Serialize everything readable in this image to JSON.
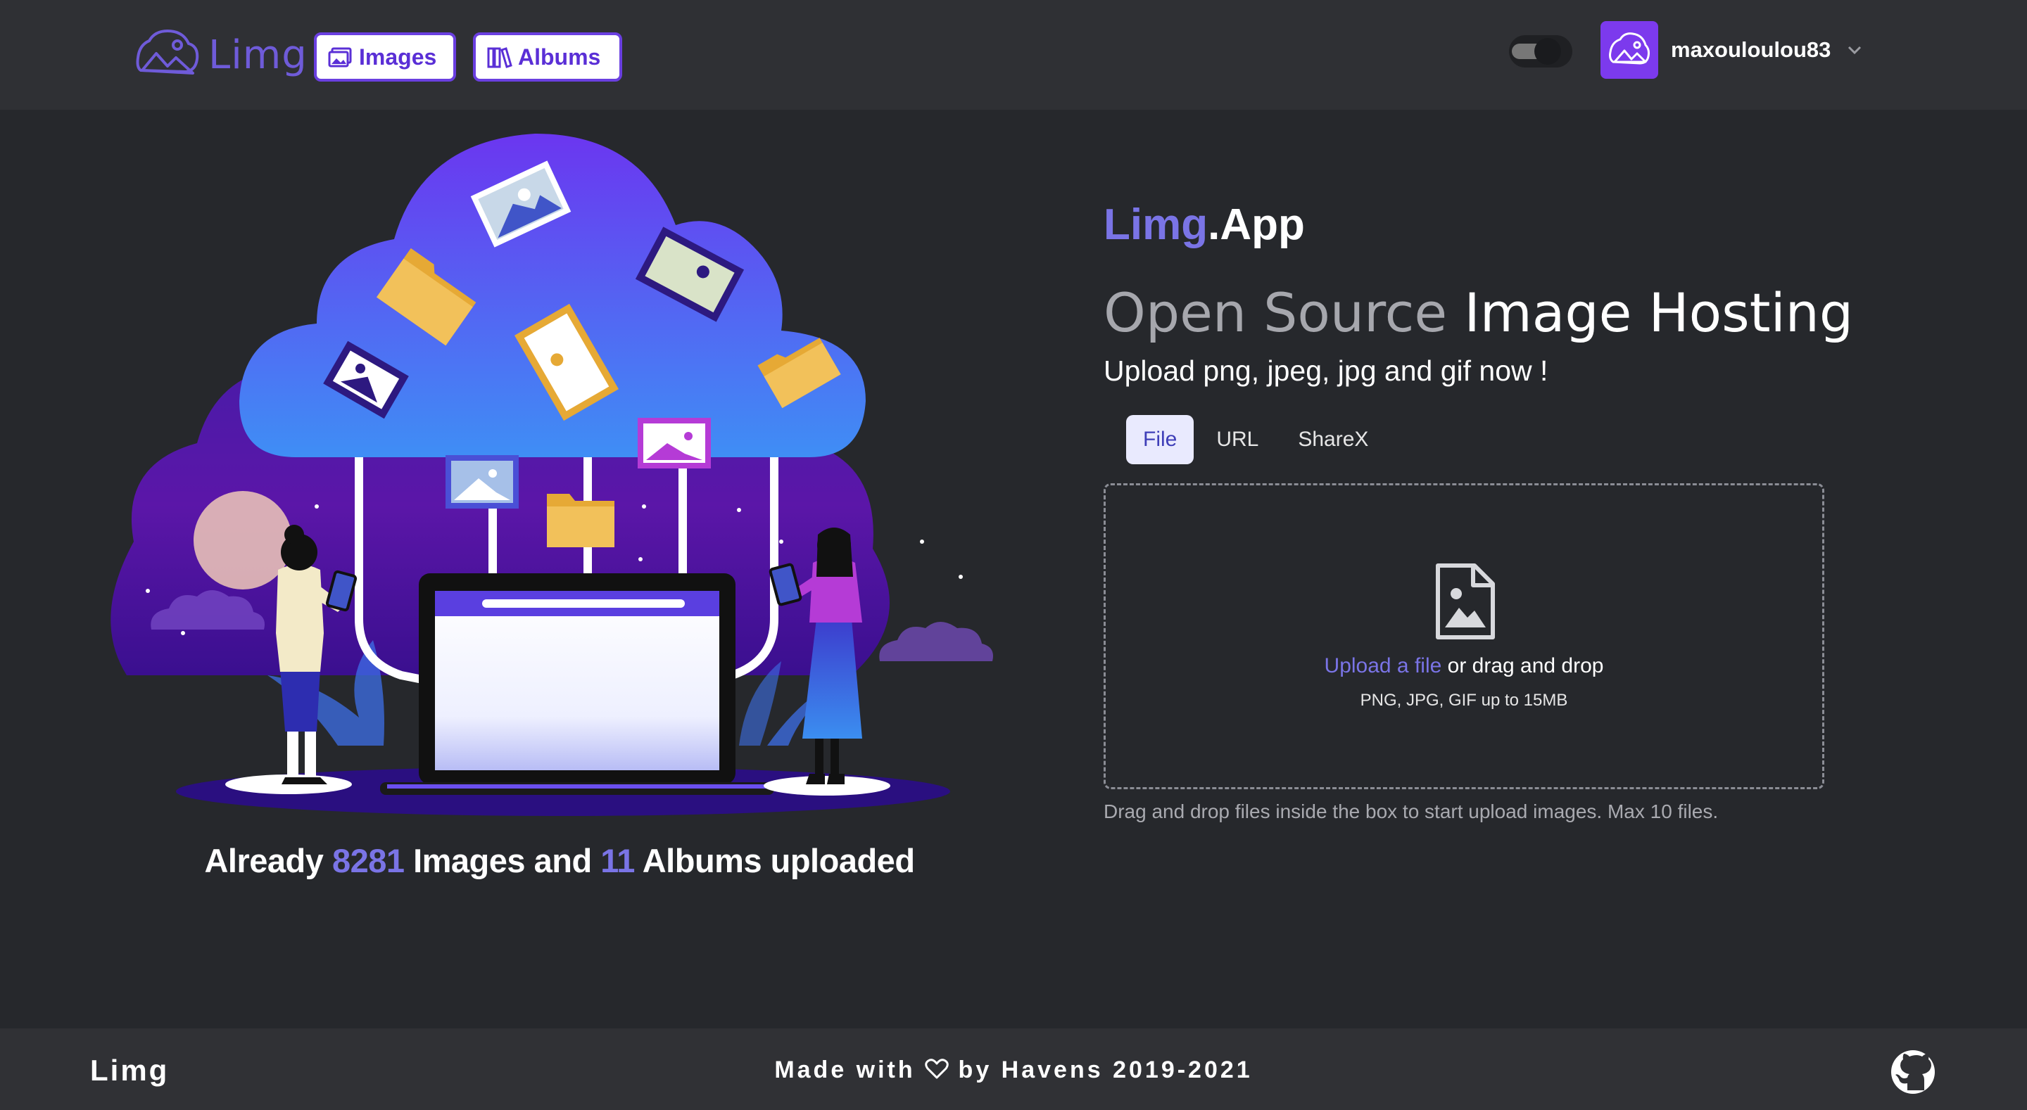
{
  "nav": {
    "logo_text": "Limg",
    "images_label": "Images",
    "albums_label": "Albums",
    "username": "maxouloulou83"
  },
  "hero": {
    "brand_part1": "Limg",
    "brand_part2": ".App",
    "headline_muted": "Open Source",
    "headline_bright": " Image Hosting",
    "subline": "Upload png, jpeg, jpg and gif now !",
    "stats_prefix": "Already ",
    "images_count": "8281",
    "stats_mid": " Images and ",
    "albums_count": "11",
    "stats_suffix": " Albums uploaded"
  },
  "upload": {
    "tabs": [
      "File",
      "URL",
      "ShareX"
    ],
    "active_tab": "File",
    "link_text": "Upload a file",
    "rest_text": " or drag and drop",
    "formats": "PNG, JPG, GIF up to 15MB",
    "hint": "Drag and drop files inside the box to start upload images. Max 10 files."
  },
  "footer": {
    "brand": "Limg",
    "made_prefix": "Made with ",
    "made_suffix": " by Havens 2019-2021"
  },
  "colors": {
    "accent": "#7a74e6",
    "nav_bg": "#2f3034",
    "page_bg": "#26282c",
    "button_border": "#6a3fe0",
    "avatar_bg": "#7c3aed"
  }
}
